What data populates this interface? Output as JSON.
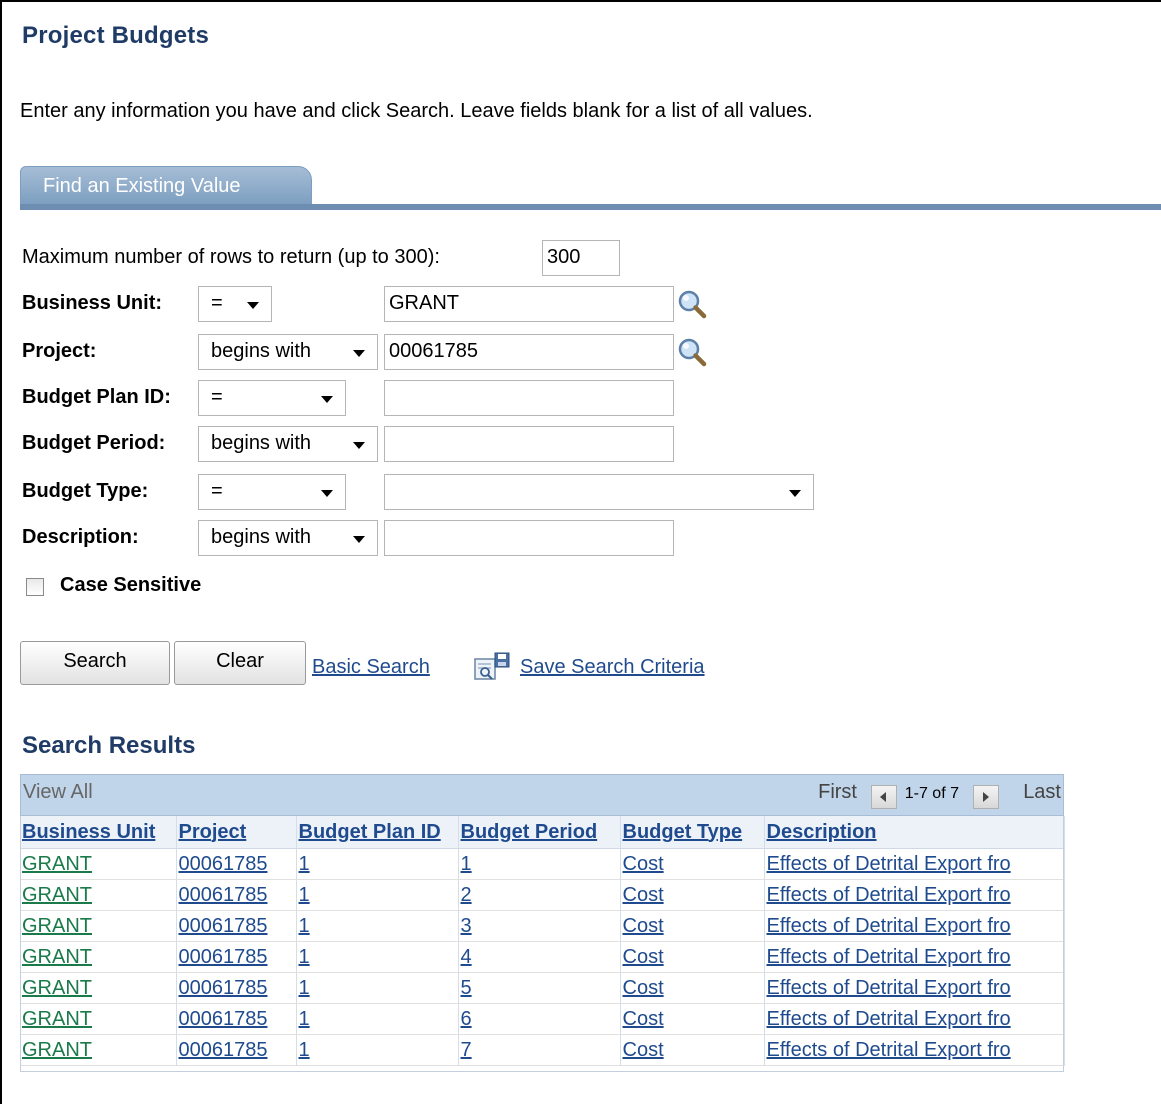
{
  "page": {
    "title": "Project Budgets",
    "instructions": "Enter any information you have and click Search. Leave fields blank for a list of all values."
  },
  "tab": {
    "label": "Find an Existing Value"
  },
  "form": {
    "max_rows_label": "Maximum number of rows to return (up to 300):",
    "max_rows_value": "300",
    "fields": [
      {
        "label": "Business Unit:",
        "operator": "=",
        "value": "GRANT"
      },
      {
        "label": "Project:",
        "operator": "begins with",
        "value": "00061785"
      },
      {
        "label": "Budget Plan ID:",
        "operator": "=",
        "value": ""
      },
      {
        "label": "Budget Period:",
        "operator": "begins with",
        "value": ""
      },
      {
        "label": "Budget Type:",
        "operator": "=",
        "value": ""
      },
      {
        "label": "Description:",
        "operator": "begins with",
        "value": ""
      }
    ],
    "case_sensitive_label": "Case Sensitive",
    "case_sensitive_checked": false
  },
  "actions": {
    "search_label": "Search",
    "clear_label": "Clear",
    "basic_search_label": "Basic Search",
    "save_criteria_label": "Save Search Criteria"
  },
  "results": {
    "title": "Search Results",
    "view_all": "View All",
    "nav_first": "First",
    "nav_range": "1-7 of 7",
    "nav_last": "Last",
    "columns": [
      "Business Unit",
      "Project",
      "Budget Plan ID",
      "Budget Period",
      "Budget Type",
      "Description"
    ],
    "rows": [
      [
        "GRANT",
        "00061785",
        "1",
        "1",
        "Cost",
        "Effects of Detrital Export fro"
      ],
      [
        "GRANT",
        "00061785",
        "1",
        "2",
        "Cost",
        "Effects of Detrital Export fro"
      ],
      [
        "GRANT",
        "00061785",
        "1",
        "3",
        "Cost",
        "Effects of Detrital Export fro"
      ],
      [
        "GRANT",
        "00061785",
        "1",
        "4",
        "Cost",
        "Effects of Detrital Export fro"
      ],
      [
        "GRANT",
        "00061785",
        "1",
        "5",
        "Cost",
        "Effects of Detrital Export fro"
      ],
      [
        "GRANT",
        "00061785",
        "1",
        "6",
        "Cost",
        "Effects of Detrital Export fro"
      ],
      [
        "GRANT",
        "00061785",
        "1",
        "7",
        "Cost",
        "Effects of Detrital Export fro"
      ]
    ]
  },
  "colors": {
    "title": "#1f3b66",
    "link": "#1f4b8e",
    "tab": "#7c9ec0",
    "grid_header": "#c0d4ea"
  }
}
